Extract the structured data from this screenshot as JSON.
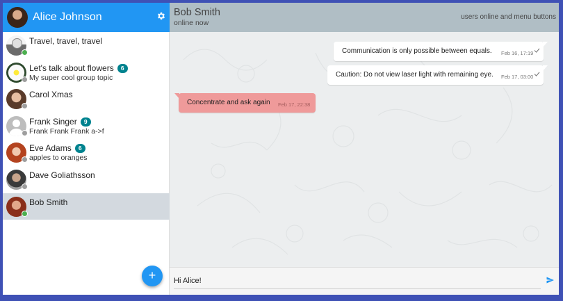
{
  "me": {
    "name": "Alice Johnson"
  },
  "contacts": [
    {
      "name": "Travel, travel, travel",
      "badge": "",
      "sub": "",
      "status": "online"
    },
    {
      "name": "Let's talk about flowers",
      "badge": "6",
      "sub": "My super cool group topic",
      "status": "offline"
    },
    {
      "name": "Carol Xmas",
      "badge": "",
      "sub": "",
      "status": "offline"
    },
    {
      "name": "Frank Singer",
      "badge": "9",
      "sub": "Frank Frank Frank a->f",
      "status": "offline"
    },
    {
      "name": "Eve Adams",
      "badge": "6",
      "sub": "apples to oranges",
      "status": "offline"
    },
    {
      "name": "Dave Goliathsson",
      "badge": "",
      "sub": "",
      "status": "offline"
    },
    {
      "name": "Bob Smith",
      "badge": "",
      "sub": "",
      "status": "online"
    }
  ],
  "chat": {
    "peer_name": "Bob Smith",
    "peer_status": "online now",
    "header_right": "users online and menu buttons",
    "messages": [
      {
        "text": "Communication is only possible between equals.",
        "time": "Feb 16, 17:19",
        "direction": "out"
      },
      {
        "text": "Caution: Do not view laser light with remaining eye.",
        "time": "Feb 17, 03:00",
        "direction": "out"
      },
      {
        "text": "Concentrate and ask again",
        "time": "Feb 17, 22:38",
        "direction": "in"
      }
    ]
  },
  "composer": {
    "value": "Hi Alice!"
  },
  "fab": {
    "label": "+"
  },
  "colors": {
    "accent": "#2196f3",
    "online": "#4caf50",
    "offline": "#9e9e9e",
    "badge": "#00838f",
    "incoming": "#ef9a9a"
  },
  "icons": [
    "gear-icon",
    "plus-icon",
    "send-icon",
    "check-icon"
  ]
}
